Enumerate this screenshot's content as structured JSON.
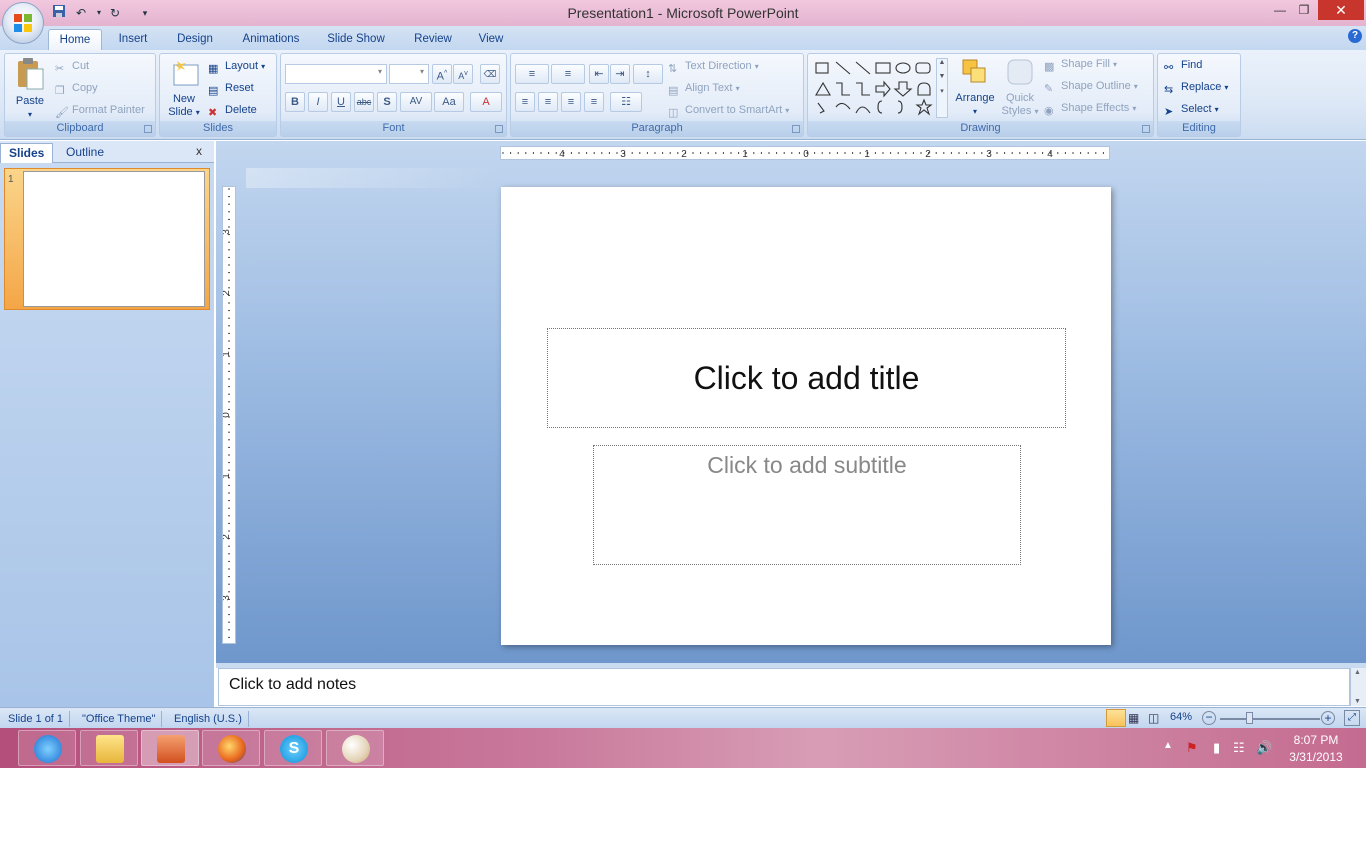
{
  "window": {
    "title": "Presentation1 - Microsoft PowerPoint"
  },
  "tabs": [
    "Home",
    "Insert",
    "Design",
    "Animations",
    "Slide Show",
    "Review",
    "View"
  ],
  "ribbon": {
    "clipboard": {
      "label": "Clipboard",
      "paste": "Paste",
      "cut": "Cut",
      "copy": "Copy",
      "format_painter": "Format Painter"
    },
    "slides": {
      "label": "Slides",
      "new_slide_1": "New",
      "new_slide_2": "Slide",
      "layout": "Layout",
      "reset": "Reset",
      "delete": "Delete"
    },
    "font": {
      "label": "Font",
      "bold": "B",
      "italic": "I",
      "underline": "U",
      "strike": "abc",
      "shadow": "S",
      "spacing": "AV",
      "case": "Aa",
      "color": "A"
    },
    "paragraph": {
      "label": "Paragraph",
      "text_direction": "Text Direction",
      "align_text": "Align Text",
      "convert_smartart": "Convert to SmartArt"
    },
    "drawing": {
      "label": "Drawing",
      "arrange": "Arrange",
      "quick_styles_1": "Quick",
      "quick_styles_2": "Styles",
      "shape_fill": "Shape Fill",
      "shape_outline": "Shape Outline",
      "shape_effects": "Shape Effects"
    },
    "editing": {
      "label": "Editing",
      "find": "Find",
      "replace": "Replace",
      "select": "Select"
    }
  },
  "left_pane": {
    "tab_slides": "Slides",
    "tab_outline": "Outline",
    "close": "x",
    "thumb_number": "1"
  },
  "slide": {
    "title_placeholder": "Click to add title",
    "subtitle_placeholder": "Click to add subtitle"
  },
  "notes": {
    "placeholder": "Click to add notes"
  },
  "rulers": {
    "h_labels": [
      "4",
      "3",
      "2",
      "1",
      "0",
      "1",
      "2",
      "3",
      "4"
    ],
    "v_labels": [
      "3",
      "2",
      "1",
      "0",
      "1",
      "2",
      "3"
    ]
  },
  "status": {
    "slide": "Slide 1 of 1",
    "theme": "\"Office Theme\"",
    "language": "English (U.S.)",
    "zoom": "64%"
  },
  "taskbar": {
    "time": "8:07 PM",
    "date": "3/31/2013"
  },
  "colors": {
    "accent": "#15428b",
    "ribbon_bg": "#dde8f6",
    "close_red": "#c7352c"
  }
}
